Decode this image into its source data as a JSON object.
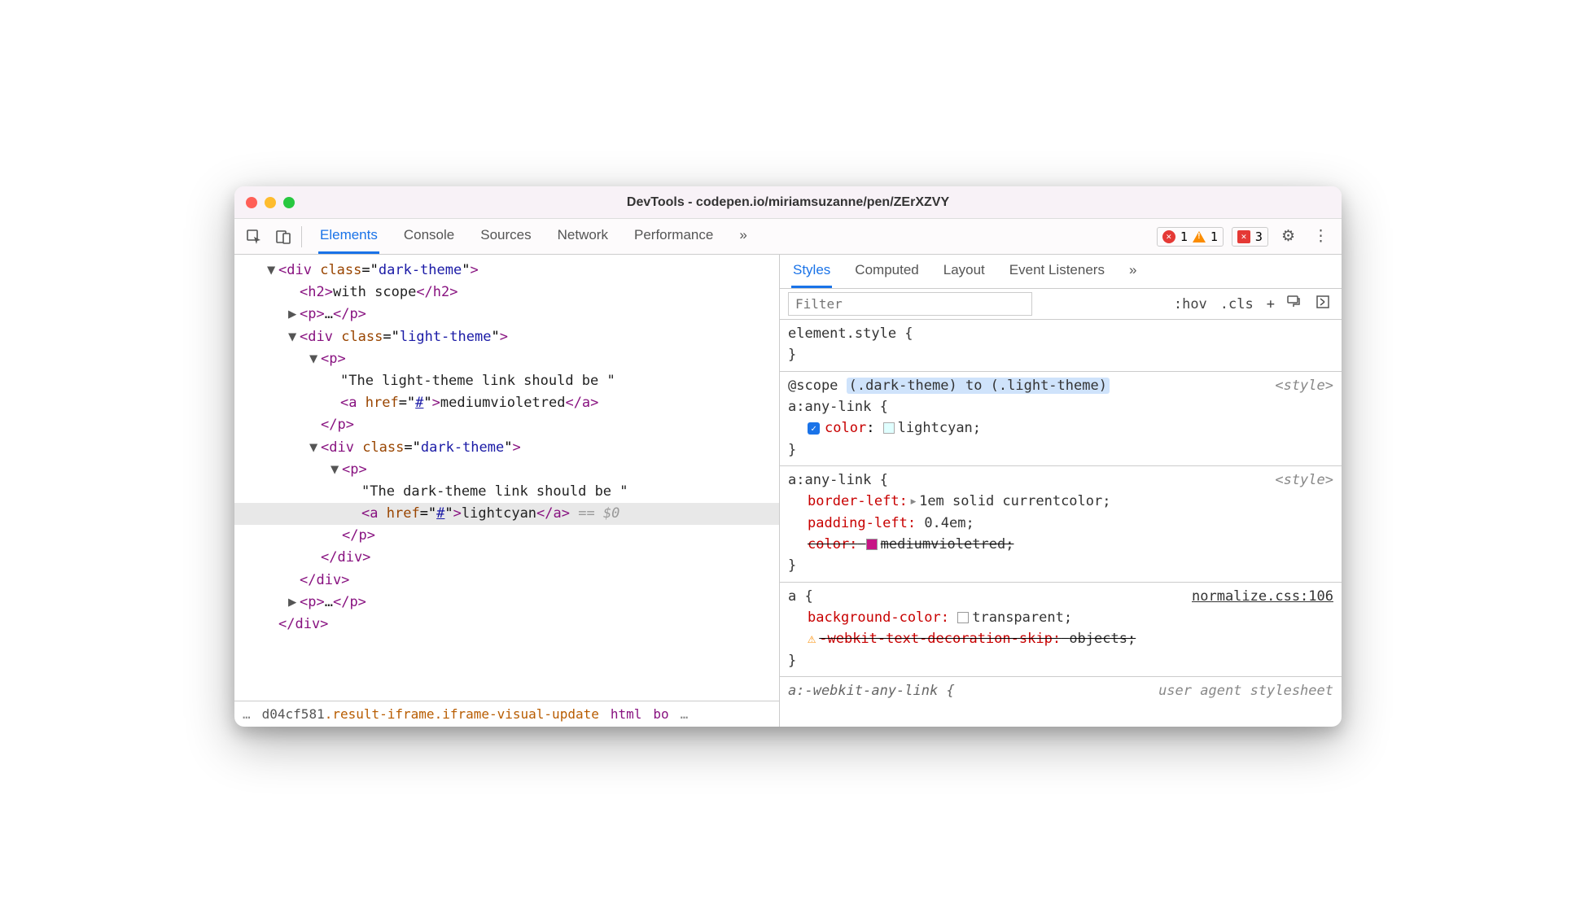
{
  "window": {
    "title": "DevTools - codepen.io/miriamsuzanne/pen/ZErXZVY"
  },
  "tabs": [
    "Elements",
    "Console",
    "Sources",
    "Network",
    "Performance"
  ],
  "tabs_more": "»",
  "badges": {
    "errors": "1",
    "warnings": "1",
    "issues": "3"
  },
  "dom": {
    "l1": {
      "open": "<div",
      "attr": "class",
      "val": "dark-theme",
      "close": ">"
    },
    "l2": {
      "open": "<h2>",
      "text": "with scope",
      "close": "</h2>"
    },
    "l3": {
      "open": "<p>",
      "dots": "…",
      "close": "</p>"
    },
    "l4": {
      "open": "<div",
      "attr": "class",
      "val": "light-theme",
      "close": ">"
    },
    "l5": {
      "open": "<p>"
    },
    "l6": {
      "text": "\"The light-theme link should be \""
    },
    "l7": {
      "open": "<a",
      "attr": "href",
      "val": "#",
      "gt": ">",
      "text": "mediumvioletred",
      "close": "</a>"
    },
    "l8": {
      "close": "</p>"
    },
    "l9": {
      "open": "<div",
      "attr": "class",
      "val": "dark-theme",
      "close": ">"
    },
    "l10": {
      "open": "<p>"
    },
    "l11": {
      "text": "\"The dark-theme link should be \""
    },
    "l12": {
      "open": "<a",
      "attr": "href",
      "val": "#",
      "gt": ">",
      "text": "lightcyan",
      "close": "</a>",
      "dollar": " == $0"
    },
    "l13": {
      "close": "</p>"
    },
    "l14": {
      "close": "</div>"
    },
    "l15": {
      "close": "</div>"
    },
    "l16": {
      "open": "<p>",
      "dots": "…",
      "close": "</p>"
    },
    "l17": {
      "close": "</div>"
    }
  },
  "breadcrumb": {
    "pre": "…",
    "hash": "d04cf581",
    "cls": ".result-iframe.iframe-visual-update",
    "html": "html",
    "body": "bo",
    "post": "…"
  },
  "subtabs": [
    "Styles",
    "Computed",
    "Layout",
    "Event Listeners"
  ],
  "subtabs_more": "»",
  "filter": {
    "placeholder": "Filter",
    "hov": ":hov",
    "cls": ".cls",
    "plus": "+"
  },
  "styles": {
    "elstyle": {
      "sel": "element.style {",
      "close": "}"
    },
    "r1": {
      "scope_pre": "@scope",
      "scope_hl": "(.dark-theme) to (.light-theme)",
      "sel": "a:any-link {",
      "src": "<style>",
      "prop": "color",
      "val": "lightcyan;",
      "swatch": "#e0ffff",
      "close": "}"
    },
    "r2": {
      "sel": "a:any-link {",
      "src": "<style>",
      "d1": {
        "prop": "border-left:",
        "val": "1em solid currentcolor;"
      },
      "d2": {
        "prop": "padding-left:",
        "val": "0.4em;"
      },
      "d3": {
        "prop": "color:",
        "val": "mediumvioletred;",
        "swatch": "#c71585"
      },
      "close": "}"
    },
    "r3": {
      "sel": "a {",
      "src": "normalize.css:106",
      "d1": {
        "prop": "background-color:",
        "val": "transparent;"
      },
      "d2": {
        "prop": "-webkit-text-decoration-skip:",
        "val": "objects;"
      },
      "close": "}"
    },
    "r4": {
      "sel": "a:-webkit-any-link {",
      "src": "user agent stylesheet"
    }
  }
}
